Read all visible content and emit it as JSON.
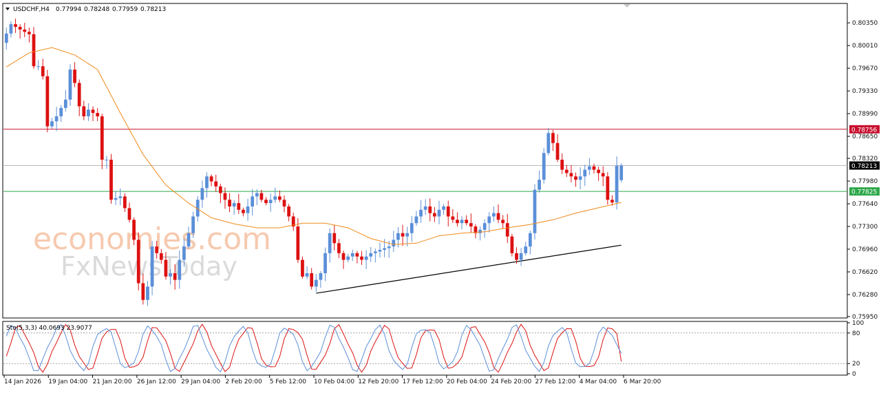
{
  "header": {
    "symbol": "USDCHF,H4",
    "open": "0.77994",
    "high": "0.78248",
    "low": "0.77959",
    "close": "0.78213"
  },
  "watermark": {
    "line1": "economies.com",
    "line2": "FxNewsToday"
  },
  "colors": {
    "bull": "#5b8fd8",
    "bear": "#dd1111",
    "ma": "#f08a1a",
    "resistance": "#c8102e",
    "support": "#2ea84a",
    "current_line": "#b8b8b8",
    "trendline": "#000000",
    "stoch_main": "#5b8fd8",
    "stoch_signal": "#dd1111"
  },
  "chart_data": [
    {
      "type": "candlestick",
      "title": "USDCHF,H4",
      "timeframe": "H4",
      "ohlc_last": {
        "open": 0.77994,
        "high": 0.78248,
        "low": 0.77959,
        "close": 0.78213
      },
      "x_ticks": [
        "14 Jan 2026",
        "19 Jan 04:00",
        "21 Jan 20:00",
        "26 Jan 12:00",
        "29 Jan 04:00",
        "2 Feb 20:00",
        "5 Feb 12:00",
        "10 Feb 04:00",
        "12 Feb 20:00",
        "17 Feb 12:00",
        "20 Feb 04:00",
        "24 Feb 20:00",
        "27 Feb 12:00",
        "4 Mar 04:00",
        "6 Mar 20:00"
      ],
      "y_ticks": [
        "0.80350",
        "0.80010",
        "0.79670",
        "0.79330",
        "0.78990",
        "0.78650",
        "0.78320",
        "0.77980",
        "0.77640",
        "0.77300",
        "0.76960",
        "0.76620",
        "0.76280",
        "0.75950"
      ],
      "ylim": [
        0.7595,
        0.8062
      ],
      "price_path": [
        [
          0,
          0.8005
        ],
        [
          2,
          0.8033
        ],
        [
          4,
          0.8025
        ],
        [
          6,
          0.8018
        ],
        [
          7,
          0.797
        ],
        [
          8,
          0.797
        ],
        [
          9,
          0.7955
        ],
        [
          10,
          0.788
        ],
        [
          12,
          0.7895
        ],
        [
          14,
          0.792
        ],
        [
          15,
          0.7965
        ],
        [
          16,
          0.7945
        ],
        [
          17,
          0.791
        ],
        [
          18,
          0.7895
        ],
        [
          19,
          0.7905
        ],
        [
          21,
          0.7895
        ],
        [
          22,
          0.783
        ],
        [
          23,
          0.783
        ],
        [
          24,
          0.777
        ],
        [
          26,
          0.7775
        ],
        [
          28,
          0.774
        ],
        [
          29,
          0.771
        ],
        [
          30,
          0.7645
        ],
        [
          31,
          0.762
        ],
        [
          32,
          0.764
        ],
        [
          33,
          0.77
        ],
        [
          35,
          0.768
        ],
        [
          36,
          0.7655
        ],
        [
          37,
          0.766
        ],
        [
          38,
          0.765
        ],
        [
          39,
          0.768
        ],
        [
          41,
          0.772
        ],
        [
          42,
          0.7745
        ],
        [
          43,
          0.777
        ],
        [
          45,
          0.7805
        ],
        [
          47,
          0.779
        ],
        [
          48,
          0.778
        ],
        [
          49,
          0.777
        ],
        [
          50,
          0.776
        ],
        [
          51,
          0.7765
        ],
        [
          52,
          0.7755
        ],
        [
          53,
          0.775
        ],
        [
          54,
          0.776
        ],
        [
          55,
          0.7775
        ],
        [
          56,
          0.778
        ],
        [
          57,
          0.777
        ],
        [
          58,
          0.7765
        ],
        [
          59,
          0.777
        ],
        [
          60,
          0.7775
        ],
        [
          61,
          0.777
        ],
        [
          62,
          0.776
        ],
        [
          63,
          0.7745
        ],
        [
          64,
          0.773
        ],
        [
          65,
          0.768
        ],
        [
          66,
          0.7655
        ],
        [
          67,
          0.766
        ],
        [
          68,
          0.764
        ],
        [
          70,
          0.766
        ],
        [
          71,
          0.769
        ],
        [
          72,
          0.772
        ],
        [
          73,
          0.7705
        ],
        [
          74,
          0.769
        ],
        [
          75,
          0.768
        ],
        [
          77,
          0.769
        ],
        [
          79,
          0.768
        ],
        [
          81,
          0.769
        ],
        [
          83,
          0.7695
        ],
        [
          85,
          0.77
        ],
        [
          86,
          0.771
        ],
        [
          87,
          0.772
        ],
        [
          88,
          0.7715
        ],
        [
          89,
          0.772
        ],
        [
          90,
          0.7735
        ],
        [
          91,
          0.7745
        ],
        [
          92,
          0.7755
        ],
        [
          93,
          0.776
        ],
        [
          94,
          0.775
        ],
        [
          95,
          0.7745
        ],
        [
          96,
          0.7755
        ],
        [
          97,
          0.776
        ],
        [
          98,
          0.7745
        ],
        [
          100,
          0.7735
        ],
        [
          101,
          0.774
        ],
        [
          103,
          0.773
        ],
        [
          104,
          0.772
        ],
        [
          105,
          0.7725
        ],
        [
          106,
          0.7735
        ],
        [
          107,
          0.7745
        ],
        [
          108,
          0.775
        ],
        [
          109,
          0.774
        ],
        [
          110,
          0.7735
        ],
        [
          111,
          0.7715
        ],
        [
          112,
          0.769
        ],
        [
          113,
          0.768
        ],
        [
          114,
          0.769
        ],
        [
          115,
          0.77
        ],
        [
          116,
          0.772
        ],
        [
          117,
          0.7785
        ],
        [
          118,
          0.78
        ],
        [
          119,
          0.784
        ],
        [
          120,
          0.787
        ],
        [
          121,
          0.7855
        ],
        [
          122,
          0.783
        ],
        [
          123,
          0.7815
        ],
        [
          124,
          0.781
        ],
        [
          125,
          0.7805
        ],
        [
          126,
          0.78
        ],
        [
          127,
          0.7805
        ],
        [
          128,
          0.7815
        ],
        [
          129,
          0.782
        ],
        [
          130,
          0.7815
        ],
        [
          131,
          0.781
        ],
        [
          132,
          0.7805
        ],
        [
          133,
          0.777
        ],
        [
          134,
          0.7766
        ],
        [
          135,
          0.7821
        ]
      ],
      "moving_average": {
        "values": [
          [
            0,
            0.7969
          ],
          [
            5,
            0.799
          ],
          [
            10,
            0.7998
          ],
          [
            15,
            0.7987
          ],
          [
            20,
            0.7965
          ],
          [
            25,
            0.79
          ],
          [
            30,
            0.7838
          ],
          [
            35,
            0.7792
          ],
          [
            40,
            0.7765
          ],
          [
            45,
            0.7743
          ],
          [
            50,
            0.7734
          ],
          [
            55,
            0.7728
          ],
          [
            60,
            0.7728
          ],
          [
            65,
            0.7735
          ],
          [
            70,
            0.7735
          ],
          [
            75,
            0.7728
          ],
          [
            80,
            0.7712
          ],
          [
            85,
            0.7703
          ],
          [
            90,
            0.7705
          ],
          [
            95,
            0.7716
          ],
          [
            100,
            0.772
          ],
          [
            105,
            0.7722
          ],
          [
            110,
            0.7728
          ],
          [
            115,
            0.7733
          ],
          [
            120,
            0.774
          ],
          [
            125,
            0.775
          ],
          [
            130,
            0.7758
          ],
          [
            135,
            0.7766
          ]
        ]
      },
      "horizontal_lines": [
        {
          "price": 0.78756,
          "label": "0.78756",
          "style": "resistance"
        },
        {
          "price": 0.78213,
          "label": "0.78213",
          "style": "current"
        },
        {
          "price": 0.77825,
          "label": "0.77825",
          "style": "support"
        }
      ],
      "trendline": {
        "from": [
          68,
          0.763
        ],
        "to": [
          135,
          0.7702
        ]
      }
    },
    {
      "type": "line",
      "title": "Sto(5,3,3) 40.0693 23.9077",
      "indicator": "Stochastic",
      "params": "5,3,3",
      "main_value": 40.0693,
      "signal_value": 23.9077,
      "y_ticks": [
        "100",
        "80",
        "20",
        "0"
      ],
      "levels": [
        80,
        20
      ],
      "ylim": [
        0,
        100
      ],
      "main_period_bars": 10,
      "main_phase": 0.6,
      "signal_lag_bars": 1.4,
      "amplitude": 42,
      "mid": 50
    }
  ]
}
